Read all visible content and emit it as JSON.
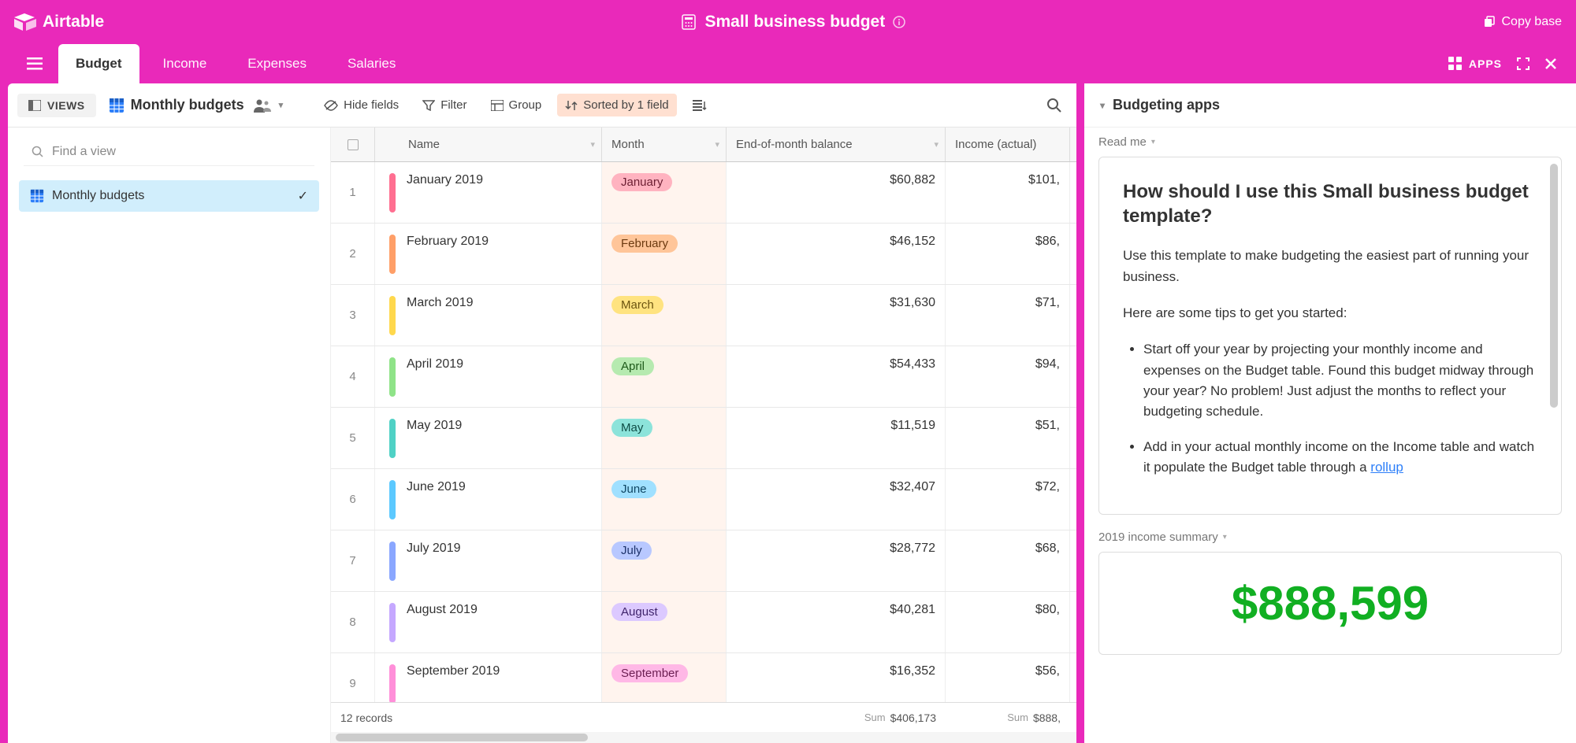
{
  "header": {
    "brand": "Airtable",
    "title": "Small business budget",
    "copy_base": "Copy base"
  },
  "tabs": [
    {
      "label": "Budget",
      "active": true
    },
    {
      "label": "Income",
      "active": false
    },
    {
      "label": "Expenses",
      "active": false
    },
    {
      "label": "Salaries",
      "active": false
    }
  ],
  "apps_label": "APPS",
  "toolbar": {
    "views": "VIEWS",
    "current_view": "Monthly budgets",
    "hide_fields": "Hide fields",
    "filter": "Filter",
    "group": "Group",
    "sorted": "Sorted by 1 field"
  },
  "sidebar": {
    "find_placeholder": "Find a view",
    "views": [
      {
        "label": "Monthly budgets",
        "active": true
      }
    ]
  },
  "grid": {
    "columns": [
      "Name",
      "Month",
      "End-of-month balance",
      "Income (actual)"
    ],
    "rows": [
      {
        "num": "1",
        "name": "January 2019",
        "month": "January",
        "balance": "$60,882",
        "income": "$101,",
        "bar": "#ff6f91",
        "pill_bg": "#ffb3c0",
        "pill_fg": "#6b1e32"
      },
      {
        "num": "2",
        "name": "February 2019",
        "month": "February",
        "balance": "$46,152",
        "income": "$86,",
        "bar": "#ff9f68",
        "pill_bg": "#ffc599",
        "pill_fg": "#6b3a10"
      },
      {
        "num": "3",
        "name": "March 2019",
        "month": "March",
        "balance": "$31,630",
        "income": "$71,",
        "bar": "#ffd84d",
        "pill_bg": "#ffe380",
        "pill_fg": "#6b5410"
      },
      {
        "num": "4",
        "name": "April 2019",
        "month": "April",
        "balance": "$54,433",
        "income": "$94,",
        "bar": "#8fe388",
        "pill_bg": "#b6eab0",
        "pill_fg": "#1e5a1a"
      },
      {
        "num": "5",
        "name": "May 2019",
        "month": "May",
        "balance": "$11,519",
        "income": "$51,",
        "bar": "#4fd1c5",
        "pill_bg": "#8ce3da",
        "pill_fg": "#0f4d46"
      },
      {
        "num": "6",
        "name": "June 2019",
        "month": "June",
        "balance": "$32,407",
        "income": "$72,",
        "bar": "#5cc9ff",
        "pill_bg": "#a0e0ff",
        "pill_fg": "#0f4663"
      },
      {
        "num": "7",
        "name": "July 2019",
        "month": "July",
        "balance": "$28,772",
        "income": "$68,",
        "bar": "#8aa7ff",
        "pill_bg": "#b8c8ff",
        "pill_fg": "#1e336b"
      },
      {
        "num": "8",
        "name": "August 2019",
        "month": "August",
        "balance": "$40,281",
        "income": "$80,",
        "bar": "#c5a8ff",
        "pill_bg": "#dcc9ff",
        "pill_fg": "#3f246b"
      },
      {
        "num": "9",
        "name": "September 2019",
        "month": "September",
        "balance": "$16,352",
        "income": "$56,",
        "bar": "#ff8fd9",
        "pill_bg": "#ffb8e6",
        "pill_fg": "#6b1e52"
      }
    ],
    "record_count": "12 records",
    "sum_label": "Sum",
    "balance_sum": "$406,173",
    "income_sum": "$888,"
  },
  "apps_panel": {
    "title": "Budgeting apps",
    "readme_label": "Read me",
    "readme": {
      "heading": "How should I use this Small business budget template?",
      "p1": "Use this template to make budgeting the easiest part of running your business.",
      "p2": "Here are some tips to get you started:",
      "li1": "Start off your year by projecting your monthly income and expenses on the Budget table. Found this budget midway through your year? No problem! Just adjust the months to reflect your budgeting schedule.",
      "li2_a": "Add in your actual monthly income on the Income table and watch it populate the Budget table through a ",
      "li2_link": "rollup"
    },
    "income_summary_label": "2019 income summary",
    "income_summary_value": "$888,599"
  }
}
